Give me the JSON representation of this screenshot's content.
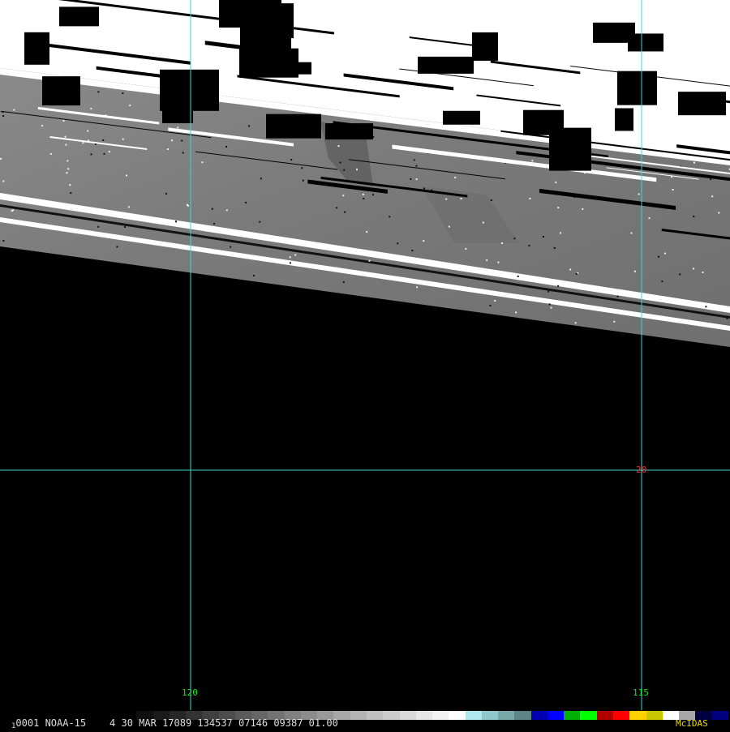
{
  "image": {
    "satellite": "NOAA-15",
    "frame_number": "0001",
    "frame_marker": "1",
    "header_text": "4 30 MAR 17089 134537 07146 09387 01.00",
    "brand": "McIDAS"
  },
  "grid": {
    "longitude_labels": [
      "120",
      "115"
    ],
    "latitude_labels": [
      "20"
    ],
    "line_color": "#3fd6d6",
    "lon_label_color": "#22dd22",
    "lat_label_color": "#ff2222"
  },
  "colorbar": {
    "stops": [
      "#000000",
      "#101010",
      "#1a1a1a",
      "#262626",
      "#333333",
      "#404040",
      "#4d4d4d",
      "#5a5a5a",
      "#666666",
      "#737373",
      "#808080",
      "#8c8c8c",
      "#999999",
      "#a6a6a6",
      "#b3b3b3",
      "#bfbfbf",
      "#cccccc",
      "#d9d9d9",
      "#e6e6e6",
      "#f2f2f2",
      "#ffffff",
      "#aee8ee",
      "#8fc8cc",
      "#78a8aa",
      "#5e8486",
      "#0000b0",
      "#0000ff",
      "#00b000",
      "#00ff00",
      "#b00000",
      "#ff0000",
      "#ffd200",
      "#c8c800",
      "#ffffff",
      "#a8a8a8",
      "#000040",
      "#000080"
    ]
  }
}
